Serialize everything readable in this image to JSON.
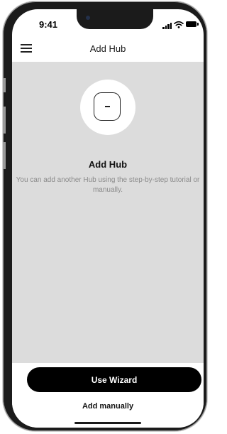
{
  "status_bar": {
    "time": "9:41",
    "icons": [
      "signal-icon",
      "wifi-icon",
      "battery-icon"
    ]
  },
  "header": {
    "title": "Add Hub",
    "menu_icon": "hamburger-menu-icon"
  },
  "main": {
    "illustration_icon": "hub-device-icon",
    "title": "Add Hub",
    "description": "You can add another Hub using the step-by-step tutorial or manually."
  },
  "actions": {
    "primary_label": "Use Wizard",
    "secondary_label": "Add manually"
  },
  "colors": {
    "content_background": "#dcdcdc",
    "primary_button": "#000000",
    "description_text": "#8b8b8b"
  }
}
